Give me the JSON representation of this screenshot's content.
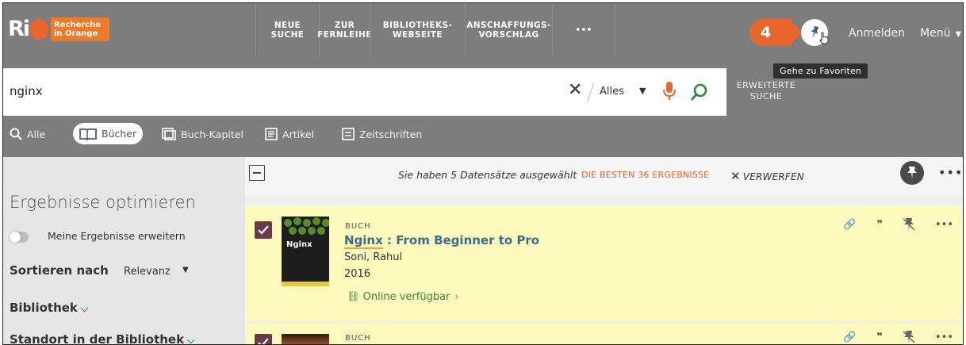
{
  "logo": {
    "mark": "Ri",
    "tag_line1": "Recherche",
    "tag_line2": "in Orange"
  },
  "nav": [
    {
      "line1": "NEUE SUCHE",
      "line2": ""
    },
    {
      "line1": "ZUR",
      "line2": "FERNLEIHE"
    },
    {
      "line1": "BIBLIOTHEKS-",
      "line2": "WEBSEITE"
    },
    {
      "line1": "ANSCHAFFUNGS-",
      "line2": "VORSCHLAG"
    },
    {
      "line1": "•••",
      "line2": ""
    }
  ],
  "header": {
    "step_badge": "4",
    "login": "Anmelden",
    "menu": "Menü",
    "tooltip": "Gehe zu Favoriten"
  },
  "search": {
    "query": "nginx",
    "scope": "Alles",
    "advanced_line1": "ERWEITERTE",
    "advanced_line2": "SUCHE"
  },
  "types": [
    {
      "label": "Alle"
    },
    {
      "label": "Bücher"
    },
    {
      "label": "Buch-Kapitel"
    },
    {
      "label": "Artikel"
    },
    {
      "label": "Zeitschriften"
    }
  ],
  "sidebar": {
    "title": "Ergebnisse optimieren",
    "expand_toggle": "Meine Ergebnisse erweitern",
    "sort_label": "Sortieren nach",
    "sort_value": "Relevanz",
    "facets": [
      "Bibliothek",
      "Standort in der Bibliothek"
    ]
  },
  "actionbar": {
    "selected_text": "Sie haben 5 Datensätze ausgewählt",
    "best_results": "DIE BESTEN 36 ERGEBNISSE",
    "discard": "VERWERFEN"
  },
  "results": [
    {
      "type": "BUCH",
      "title_highlight": "Nginx",
      "title_rest": " : From Beginner to Pro",
      "author": "Soni, Rahul",
      "year": "2016",
      "availability": "Online verfügbar",
      "cover_text": "Nginx"
    },
    {
      "type": "BUCH"
    }
  ],
  "colors": {
    "brand_orange": "#e8652b",
    "bar_gray": "#7d7d7d",
    "selected_bg": "#fbfabc",
    "check_purple": "#6a3a4a"
  }
}
